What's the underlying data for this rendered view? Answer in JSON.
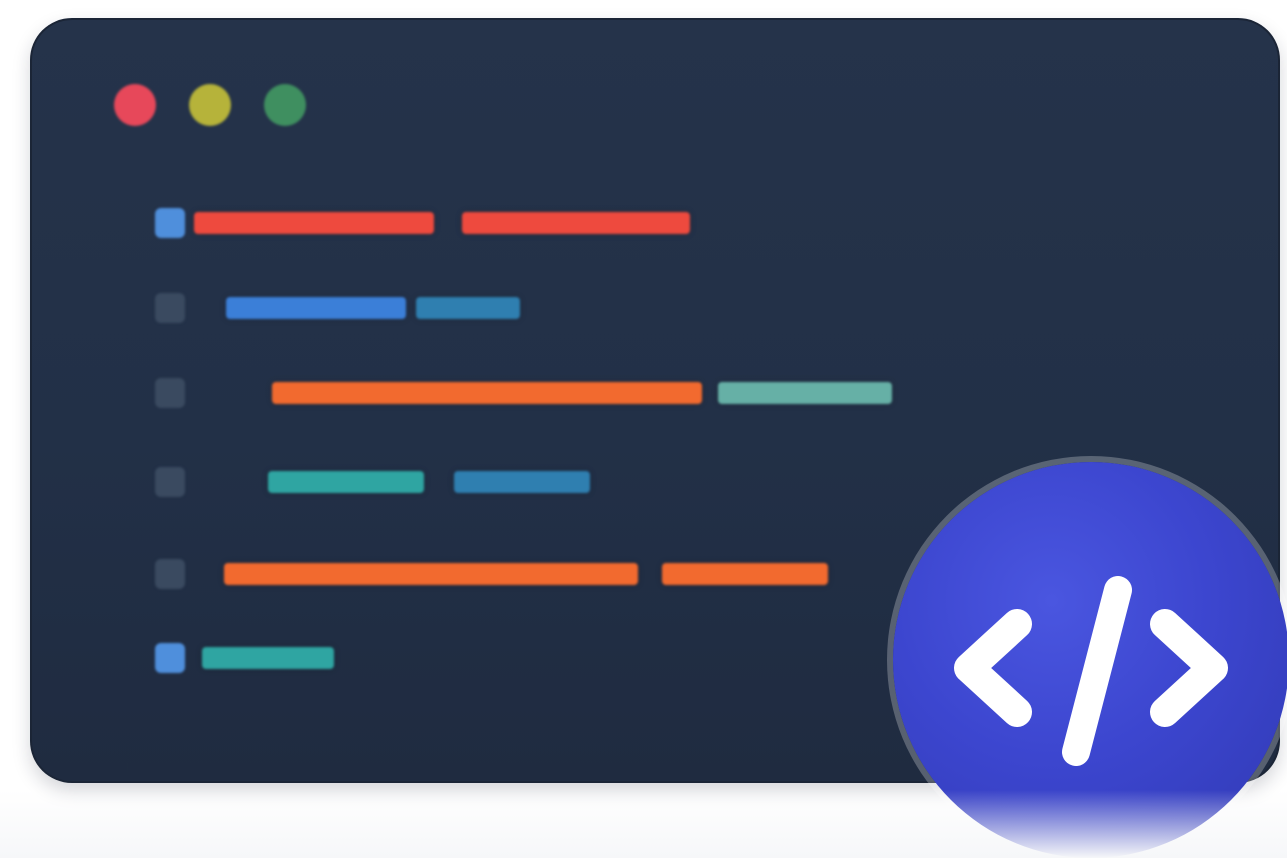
{
  "colors": {
    "window_background": "#24324a",
    "dot_red": "#e7485a",
    "dot_yellow": "#b6b33a",
    "dot_green": "#3f8f60",
    "gutter_bright": "#4f8fdc",
    "gutter_dim": "#3a4a60",
    "token_red": "#ee4a3e",
    "token_orange": "#f26a2f",
    "token_blue": "#3b7fd8",
    "token_steelblue": "#2f7fb0",
    "token_teal": "#2fa5a2",
    "token_sage": "#66b0a6",
    "badge": "#3c46cf",
    "badge_glyph": "#ffffff"
  },
  "icons": {
    "window_controls": [
      "close-dot",
      "minimize-dot",
      "maximize-dot"
    ],
    "badge": "code-brackets-icon"
  },
  "code_lines": [
    {
      "gutter": "bright",
      "tokens": [
        "red",
        "red"
      ]
    },
    {
      "gutter": "dim",
      "tokens": [
        "blue",
        "steelblue"
      ]
    },
    {
      "gutter": "dim",
      "tokens": [
        "orange",
        "sage"
      ]
    },
    {
      "gutter": "dim",
      "tokens": [
        "teal",
        "steelblue"
      ]
    },
    {
      "gutter": "dim",
      "tokens": [
        "orange",
        "orange"
      ]
    },
    {
      "gutter": "bright",
      "tokens": [
        "teal"
      ]
    }
  ]
}
